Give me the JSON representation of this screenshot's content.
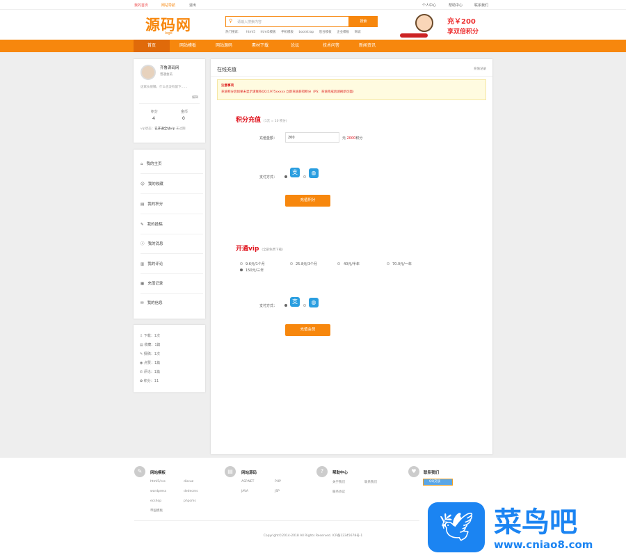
{
  "topbar": {
    "left": [
      "我的首页",
      "网站导航",
      "退出"
    ],
    "right": [
      "个人中心",
      "帮助中心",
      "联系我们"
    ]
  },
  "header": {
    "logo": "源码网",
    "logo_sub": "logo",
    "search_placeholder": "请输入搜索内容",
    "search_button": "搜索",
    "hot_label": "热门搜索：",
    "hot": [
      "html5",
      "html5模板",
      "手机模板",
      "bootstrap",
      "后台模板",
      "企业模板",
      "商城"
    ],
    "banner_line1": "充￥200",
    "banner_line2": "享双倍积分"
  },
  "nav": [
    "首页",
    "网站模板",
    "网站源码",
    "素材下载",
    "论坛",
    "技术问答",
    "新闻资讯"
  ],
  "profile": {
    "name": "齐鲁源码网",
    "status": "普通会员",
    "bio": "这家伙很懒，什么也没有留下……",
    "edit": "编辑",
    "stats": [
      {
        "label": "积分",
        "value": "4"
      },
      {
        "label": "金币",
        "value": "0"
      }
    ],
    "vip_label": "vip状态：",
    "vip_value": "已开通全站vip",
    "vip_exp": "未过期"
  },
  "menu": [
    {
      "icon": "⌂",
      "label": "我的主页"
    },
    {
      "icon": "☺",
      "label": "我的收藏"
    },
    {
      "icon": "▤",
      "label": "我的积分"
    },
    {
      "icon": "✎",
      "label": "我的投稿"
    },
    {
      "icon": "ⓘ",
      "label": "我的消息"
    },
    {
      "icon": "▥",
      "label": "我的评论"
    },
    {
      "icon": "▦",
      "label": "充值记录"
    },
    {
      "icon": "✉",
      "label": "我的信息"
    }
  ],
  "counts": [
    {
      "icon": "⇩",
      "label": "下载：1次"
    },
    {
      "icon": "▤",
      "label": "收藏：1篇"
    },
    {
      "icon": "✎",
      "label": "投稿：1次"
    },
    {
      "icon": "◉",
      "label": "点赞：1篇"
    },
    {
      "icon": "✆",
      "label": "评论：1篇"
    },
    {
      "icon": "✿",
      "label": "积分：11"
    }
  ],
  "main": {
    "title": "在线充值",
    "record_link": "充值记录",
    "notice_title": "注意事项",
    "notice_text": "充值积分后如果未显示请联系QQ:1975xxxxx 立即充值获得积分（PS：充值完成后请刷新页面）",
    "points": {
      "title": "积分充值",
      "subtitle": "(1元 = 10 积分)",
      "amount_label": "充值金额：",
      "amount_value": "200",
      "unit": "元",
      "points_value": "2000",
      "points_unit": "积分",
      "pay_label": "支付方式：",
      "button": "充值积分"
    },
    "vip": {
      "title": "开通vip",
      "subtitle": "(全部免费下载)",
      "options": [
        {
          "label": "9.6元/1个月",
          "selected": false
        },
        {
          "label": "25.8元/3个月",
          "selected": false
        },
        {
          "label": "40元/半年",
          "selected": false
        },
        {
          "label": "70.0元/一年",
          "selected": false
        },
        {
          "label": "150元/三年",
          "selected": true
        }
      ],
      "pay_label": "支付方式：",
      "button": "充值会员"
    }
  },
  "footer": {
    "columns": [
      {
        "icon": "✎",
        "title": "网站模板",
        "links": [
          "html5/css",
          "discuz",
          "wordpress",
          "dedecms",
          "ecshop",
          "phpcms",
          "帝国模板"
        ]
      },
      {
        "icon": "▤",
        "title": "网站源码",
        "links": [
          "ASP.NET",
          "PHP",
          "JAVA",
          "JSP"
        ]
      },
      {
        "icon": "?",
        "title": "帮助中心",
        "links": [
          "关于我们",
          "联系我们",
          "服务协议"
        ]
      },
      {
        "icon": "♥",
        "title": "联系我们",
        "links": [
          "QQ交谈"
        ]
      }
    ],
    "copyright": "Copyright©2014-2018 All Rights Reserved.  ICP备12345678号-1"
  },
  "watermark": {
    "text": "菜鸟吧",
    "url": "www.cniao8.com"
  },
  "colors": {
    "accent": "#f7870d",
    "red": "#e0141e",
    "pay": "#2a9ee0"
  }
}
